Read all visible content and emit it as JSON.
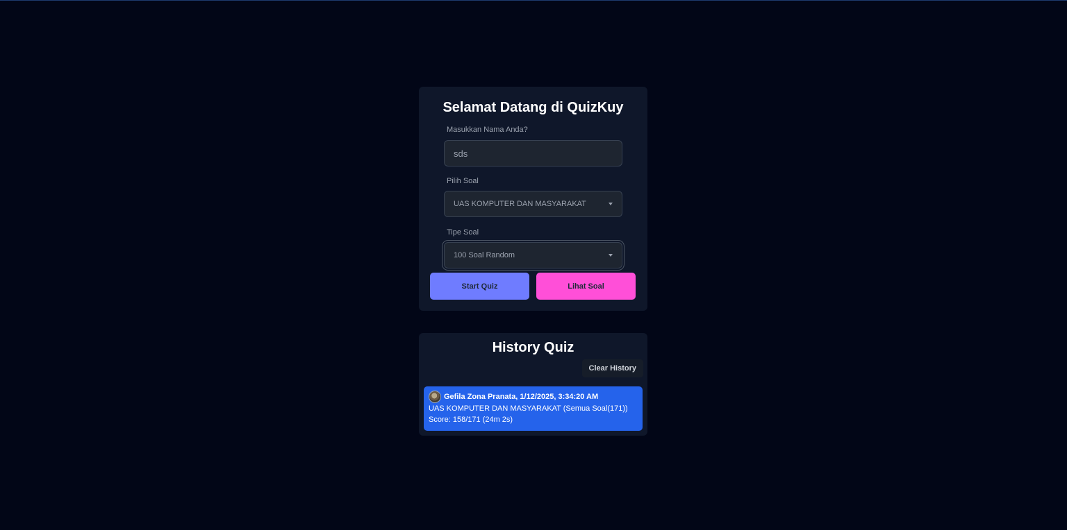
{
  "welcome": {
    "title": "Selamat Datang di QuizKuy",
    "name_label": "Masukkan Nama Anda?",
    "name_value": "sds",
    "soal_label": "Pilih Soal",
    "soal_selected": "UAS KOMPUTER DAN MASYARAKAT",
    "tipe_label": "Tipe Soal",
    "tipe_selected": "100 Soal Random",
    "start_button": "Start Quiz",
    "lihat_button": "Lihat Soal"
  },
  "history": {
    "title": "History Quiz",
    "clear_button": "Clear History",
    "items": [
      {
        "header": "Gefila Zona Pranata, 1/12/2025, 3:34:20 AM",
        "quiz": "UAS KOMPUTER DAN MASYARAKAT (Semua Soal(171))",
        "score": "Score: 158/171 (24m 2s)"
      }
    ]
  },
  "colors": {
    "background": "#020617",
    "card": "#0f172a",
    "start_button": "#6f7cff",
    "lihat_button": "#ff4fd8",
    "history_item": "#2563eb"
  }
}
